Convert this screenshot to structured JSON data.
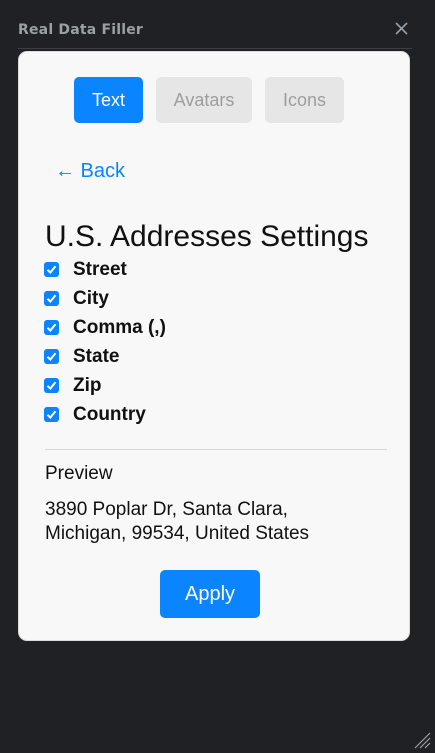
{
  "window": {
    "title": "Real Data Filler"
  },
  "tabs": [
    {
      "label": "Text",
      "active": true
    },
    {
      "label": "Avatars",
      "active": false
    },
    {
      "label": "Icons",
      "active": false
    }
  ],
  "back_label": "← Back",
  "heading": "U.S. Addresses Settings",
  "options": [
    {
      "label": "Street",
      "checked": true
    },
    {
      "label": "City",
      "checked": true
    },
    {
      "label": "Comma (,)",
      "checked": true
    },
    {
      "label": "State",
      "checked": true
    },
    {
      "label": "Zip",
      "checked": true
    },
    {
      "label": "Country",
      "checked": true
    }
  ],
  "preview": {
    "label": "Preview",
    "text": "3890 Poplar Dr, Santa Clara, Michigan, 99534, United States"
  },
  "apply_label": "Apply",
  "colors": {
    "accent": "#0a84ff",
    "background": "#202124",
    "card": "#f8f8f8"
  }
}
